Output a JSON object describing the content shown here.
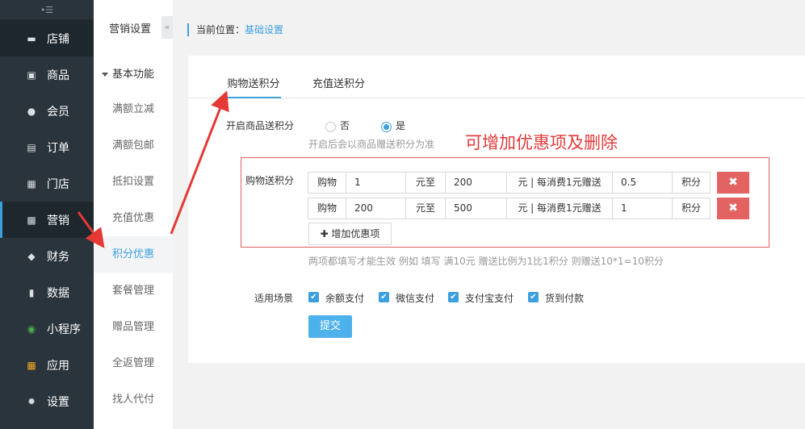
{
  "nav": {
    "toggle": "•☰",
    "items": [
      {
        "label": "店铺",
        "icon": "▬"
      },
      {
        "label": "商品",
        "icon": "▣"
      },
      {
        "label": "会员",
        "icon": "●"
      },
      {
        "label": "订单",
        "icon": "▤"
      },
      {
        "label": "门店",
        "icon": "▦"
      },
      {
        "label": "营销",
        "icon": "▩"
      },
      {
        "label": "财务",
        "icon": "◆"
      },
      {
        "label": "数据",
        "icon": "▮"
      },
      {
        "label": "小程序",
        "icon": "◉"
      },
      {
        "label": "应用",
        "icon": "▦"
      },
      {
        "label": "设置",
        "icon": "✹"
      }
    ]
  },
  "submenu": {
    "title": "营销设置",
    "collapse": "«",
    "group": "基本功能",
    "items": [
      "满额立减",
      "满额包邮",
      "抵扣设置",
      "充值优惠",
      "积分优惠",
      "套餐管理",
      "赠品管理",
      "全返管理",
      "找人代付"
    ]
  },
  "breadcrumb": {
    "prefix": "当前位置：",
    "current": "基础设置"
  },
  "tabs": [
    "购物送积分",
    "充值送积分"
  ],
  "form": {
    "enable_label": "开启商品送积分",
    "radio_no": "否",
    "radio_yes": "是",
    "enable_hint": "开启后会以商品赠送积分为准",
    "annotation": "可增加优惠项及删除",
    "rules_label": "购物送积分",
    "row_text": {
      "buy": "购物",
      "to": "元至",
      "per": "元 | 每消费1元赠送",
      "unit": "积分",
      "delete": "✖"
    },
    "rows": [
      {
        "from": "1",
        "to": "200",
        "ratio": "0.5"
      },
      {
        "from": "200",
        "to": "500",
        "ratio": "1"
      }
    ],
    "add_label": "✚ 增加优惠项",
    "rules_hint": "两项都填写才能生效 例如 填写 满10元 赠送比例为1比1积分 则赠送10*1=10积分",
    "scene_label": "适用场景",
    "scenes": [
      "余额支付",
      "微信支付",
      "支付宝支付",
      "货到付款"
    ],
    "submit": "提交"
  }
}
